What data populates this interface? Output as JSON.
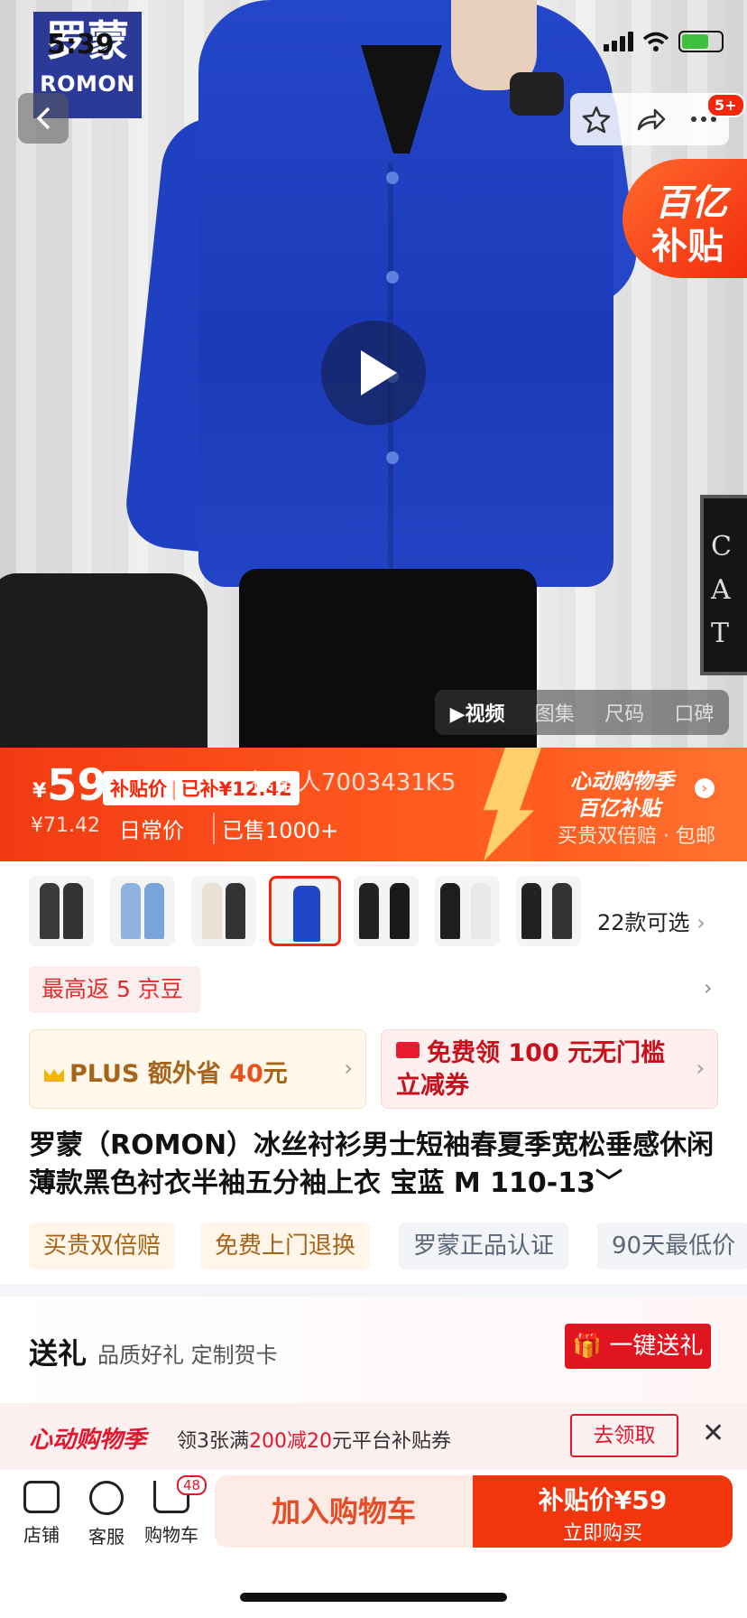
{
  "status_bar": {
    "time": "5:39"
  },
  "hero": {
    "brand_logo_cn": "罗蒙",
    "brand_logo_en": "ROMON",
    "share_badge": "5+",
    "subsidy_sticker": [
      "百亿",
      "补贴"
    ],
    "media_tabs": [
      "▶视频",
      "图集",
      "尺码",
      "口碑"
    ],
    "frame_text": "C\nA\nT"
  },
  "price": {
    "currency": "¥",
    "value": "59",
    "subsidy_label": "补贴价",
    "subsidy_saved": "已补¥12.42",
    "watermark": "操星人7003431K5",
    "original": "¥71.42",
    "daily_label": "日常价",
    "sold": "已售1000+",
    "event_title": "心动购物季",
    "event_sub": "百亿补贴",
    "event_benefits": "买贵双倍赔 · 包邮"
  },
  "sku": {
    "more_label": "22款可选"
  },
  "coins": {
    "label": "最高返 5 京豆"
  },
  "plus_card": {
    "prefix": "PLUS 额外省 ",
    "amount": "40",
    "suffix": "元"
  },
  "coupon_card": {
    "label": "免费领 100 元无门槛立减券"
  },
  "product_title": "罗蒙（ROMON）冰丝衬衫男士短袖春夏季宽松垂感休闲薄款黑色衬衣半袖五分袖上衣 宝蓝 M 110-13﹀",
  "service_tags": [
    "买贵双倍赔",
    "免费上门退换",
    "罗蒙正品认证",
    "90天最低价"
  ],
  "gift": {
    "title": "送礼",
    "sub": "品质好礼 定制贺卡",
    "button": "一键送礼"
  },
  "promo": {
    "logo": "心动购物季",
    "text_a": "领3张满",
    "text_b": "200减20",
    "text_c": "元平台补贴券",
    "button": "去领取"
  },
  "bottom": {
    "store": "店铺",
    "service": "客服",
    "cart": "购物车",
    "cart_count": "48",
    "add_cart": "加入购物车",
    "buy_price": "补贴价¥59",
    "buy_now": "立即购买"
  }
}
